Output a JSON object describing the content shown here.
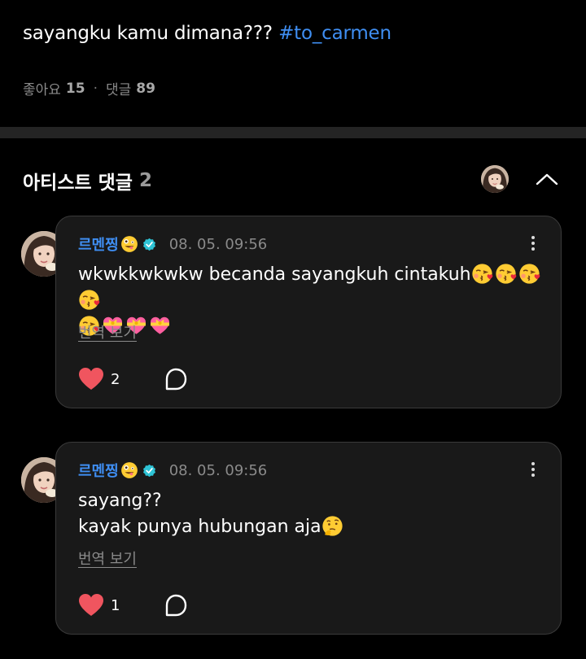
{
  "post": {
    "text": "sayangku kamu dimana??? ",
    "hashtag": "#to_carmen",
    "likes_label": "좋아요",
    "likes_count": "15",
    "separator": "·",
    "comments_label": "댓글",
    "comments_count": "89"
  },
  "artist_comments": {
    "title": "아티스트 댓글",
    "count": "2"
  },
  "comments": [
    {
      "author": "르멘찡",
      "author_emoji": "zany-face-emoji",
      "verified": "verified-badge-icon",
      "date": "08. 05. 09:56",
      "body": "wkwkkwkwkw becanda sayangkuh cintakuh",
      "body_emojis_line1": [
        "kissing-heart-emoji",
        "kissing-heart-emoji",
        "kissing-heart-emoji",
        "kissing-heart-emoji"
      ],
      "body_emojis_line2": [
        "kissing-heart-emoji",
        "heart-with-ribbon-emoji",
        "heart-with-ribbon-emoji",
        "heart-with-ribbon-emoji"
      ],
      "translate": "번역 보기",
      "likes": "2"
    },
    {
      "author": "르멘찡",
      "author_emoji": "zany-face-emoji",
      "verified": "verified-badge-icon",
      "date": "08. 05. 09:56",
      "body_line1": "sayang??",
      "body_line2": "kayak punya hubungan aja",
      "body_emoji": "thinking-face-emoji",
      "translate": "번역 보기",
      "likes": "1"
    }
  ],
  "colors": {
    "background": "#000000",
    "card": "#191919",
    "card_border": "#3a3a3a",
    "accent": "#3f8ef2",
    "heart": "#f0555f",
    "verified": "#2ec4d6",
    "muted": "#8a8a8a"
  }
}
